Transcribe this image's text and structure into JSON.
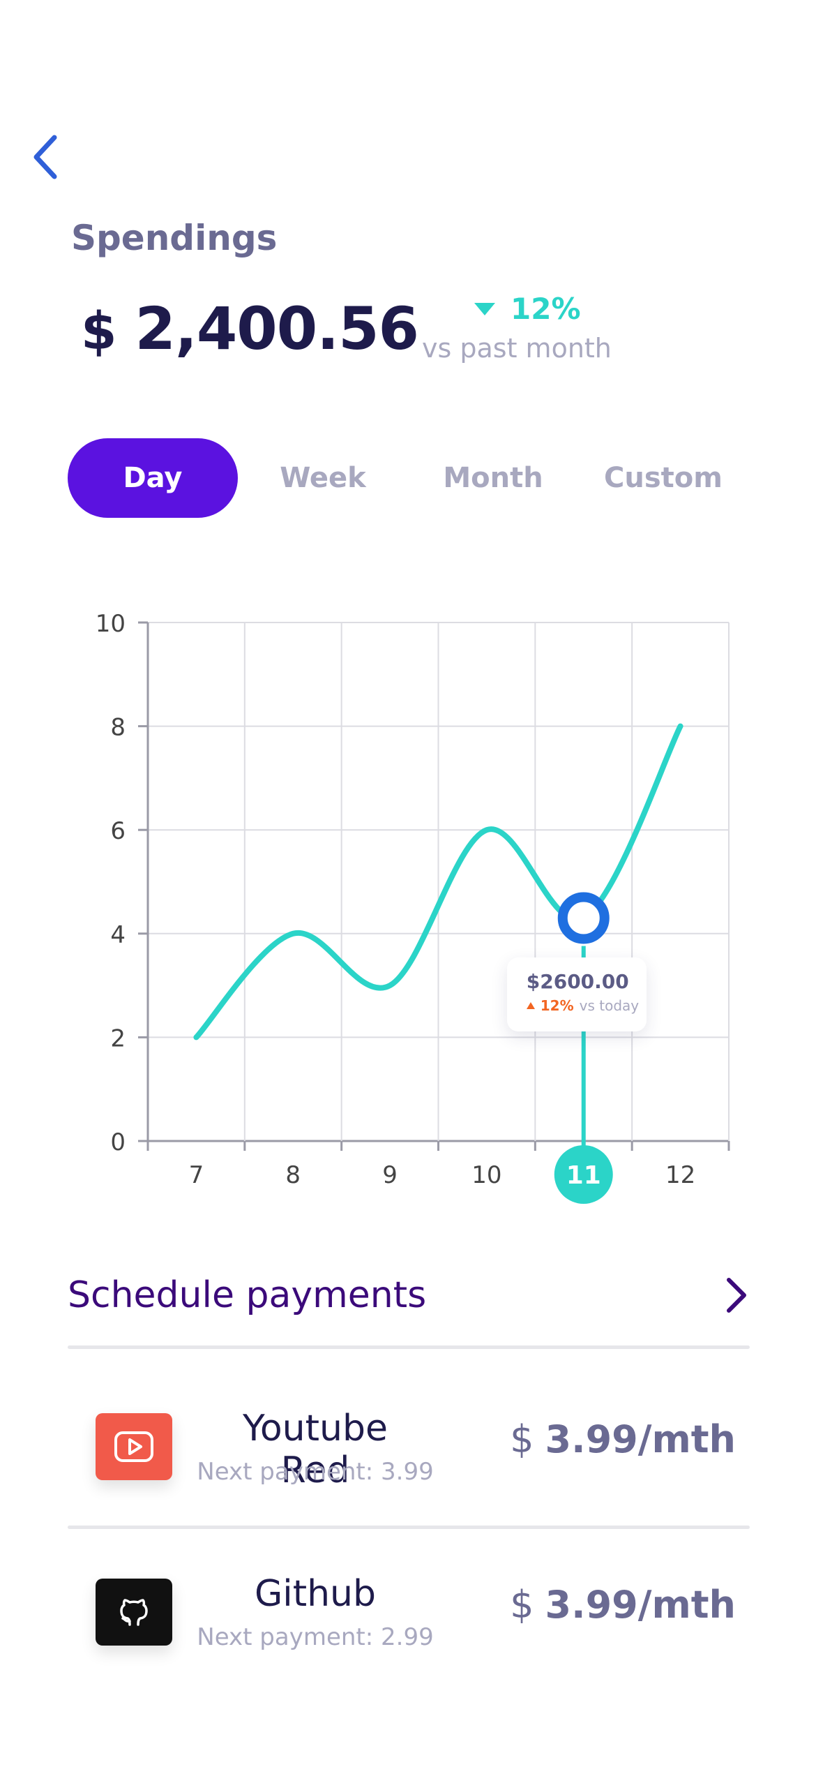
{
  "colors": {
    "accent": "#5b12e0",
    "teal": "#2bd4c8",
    "navy": "#1e1b4b",
    "muted": "#a8a8bf",
    "muted_strong": "#6a6a92",
    "marker": "#1f6fe0",
    "youtube_red": "#f15a4a",
    "github_black": "#111111",
    "orange": "#f26522"
  },
  "header": {
    "back_icon": "chevron-left-icon",
    "title": "Spendings",
    "currency": "$",
    "amount": "2,400.56",
    "delta_icon": "triangle-down-icon",
    "delta_value": "12%",
    "delta_caption": "vs past month"
  },
  "tabs": [
    {
      "label": "Day",
      "active": true
    },
    {
      "label": "Week",
      "active": false
    },
    {
      "label": "Month",
      "active": false
    },
    {
      "label": "Custom",
      "active": false
    }
  ],
  "chart_data": {
    "type": "line",
    "x": [
      7,
      8,
      9,
      10,
      11,
      12
    ],
    "y": [
      2,
      4,
      3,
      6,
      4.3,
      8
    ],
    "x_tick_labels": [
      "7",
      "8",
      "9",
      "10",
      "11",
      "12"
    ],
    "y_ticks": [
      0,
      2,
      4,
      6,
      8,
      10
    ],
    "xlim": [
      6.5,
      12.5
    ],
    "ylim": [
      0,
      10
    ],
    "grid": true,
    "selected": {
      "x": 11,
      "x_label": "11",
      "tooltip_value": "$2600.00",
      "tooltip_delta": "12%",
      "tooltip_caption": "vs today"
    }
  },
  "schedule": {
    "title": "Schedule payments",
    "chevron_icon": "chevron-right-icon",
    "items": [
      {
        "icon": "youtube-play-icon",
        "name": "Youtube Red",
        "subtitle": "Next payment: 3.99",
        "currency": "$",
        "price": "3.99/mth"
      },
      {
        "icon": "github-icon",
        "name": "Github",
        "subtitle": "Next payment: 2.99",
        "currency": "$",
        "price": "3.99/mth"
      }
    ]
  }
}
